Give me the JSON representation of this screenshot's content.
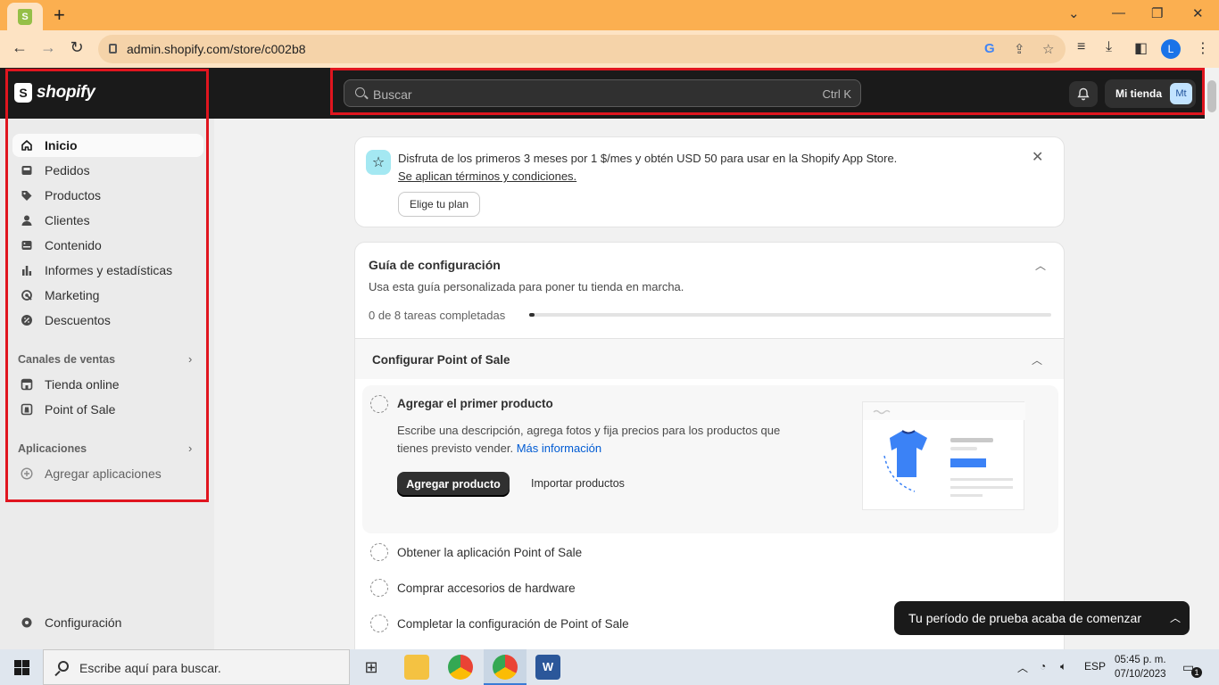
{
  "browser": {
    "url": "admin.shopify.com/store/c002b8",
    "profile_initial": "L",
    "new_tab_glyph": "+"
  },
  "topbar": {
    "logo_text": "shopify",
    "logo_glyph": "S",
    "search_placeholder": "Buscar",
    "search_shortcut": "Ctrl K",
    "store_name": "Mi tienda",
    "store_initials": "Mt"
  },
  "sidebar": {
    "items": [
      {
        "label": "Inicio",
        "icon": "home-icon"
      },
      {
        "label": "Pedidos",
        "icon": "orders-icon"
      },
      {
        "label": "Productos",
        "icon": "tag-icon"
      },
      {
        "label": "Clientes",
        "icon": "person-icon"
      },
      {
        "label": "Contenido",
        "icon": "content-icon"
      },
      {
        "label": "Informes y estadísticas",
        "icon": "chart-icon"
      },
      {
        "label": "Marketing",
        "icon": "target-icon"
      },
      {
        "label": "Descuentos",
        "icon": "discount-icon"
      }
    ],
    "sales_channels_label": "Canales de ventas",
    "sales_channels": [
      {
        "label": "Tienda online",
        "icon": "store-icon"
      },
      {
        "label": "Point of Sale",
        "icon": "pos-icon"
      }
    ],
    "apps_label": "Aplicaciones",
    "add_apps_label": "Agregar aplicaciones",
    "settings_label": "Configuración"
  },
  "banner": {
    "text": "Disfruta de los primeros 3 meses por 1 $/mes y obtén USD 50 para usar en la Shopify App Store.",
    "link": "Se aplican términos y condiciones.",
    "button": "Elige tu plan"
  },
  "guide": {
    "title": "Guía de configuración",
    "subtitle": "Usa esta guía personalizada para poner tu tienda en marcha.",
    "progress_label": "0 de 8 tareas completadas",
    "progress_value": 0.01,
    "section_title": "Configurar Point of Sale",
    "active_task": {
      "title": "Agregar el primer producto",
      "desc_line1": "Escribe una descripción, agrega fotos y fija precios para los productos que",
      "desc_line2": "tienes previsto vender.",
      "link": "Más información",
      "primary_button": "Agregar producto",
      "secondary_button": "Importar productos"
    },
    "tasks": [
      "Obtener la aplicación Point of Sale",
      "Comprar accesorios de hardware",
      "Completar la configuración de Point of Sale"
    ]
  },
  "toast": {
    "text": "Tu período de prueba acaba de comenzar"
  },
  "taskbar": {
    "search_placeholder": "Escribe aquí para buscar.",
    "language": "ESP",
    "time": "05:45 p. m.",
    "date": "07/10/2023",
    "notification_count": "1"
  }
}
